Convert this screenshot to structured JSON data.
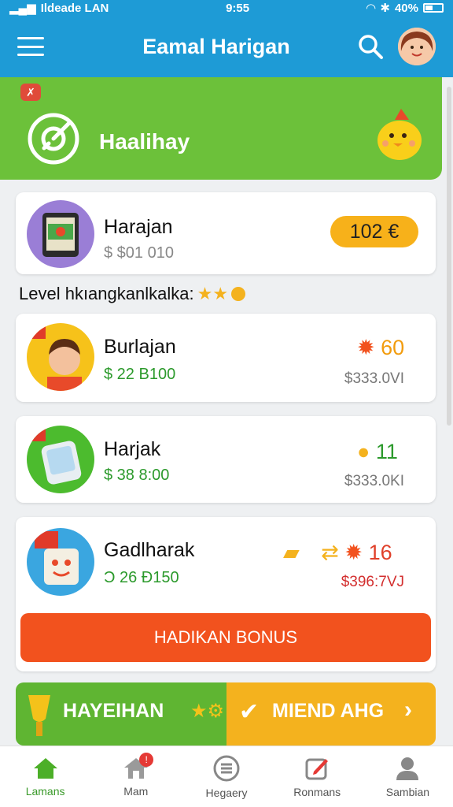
{
  "status_bar": {
    "left": "Ildeade LAN",
    "time": "9:55",
    "battery": "40%"
  },
  "header": {
    "title": "Eamal Harigan"
  },
  "banner": {
    "badge": "✗",
    "title": "Haalihay"
  },
  "featured": {
    "name": "Harajan",
    "price": "$ $01 010",
    "pill": "102 €"
  },
  "level": {
    "text": "Level hkıangkanlkalka:"
  },
  "items": [
    {
      "name": "Burlajan",
      "price": "$ 22 B100",
      "value": "60",
      "sub": "$333.0VI"
    },
    {
      "name": "Harjak",
      "price": "$ 38 8:00",
      "value": "11",
      "sub": "$333.0KI"
    },
    {
      "name": "Gadlharak",
      "price": "Ͻ 26 Ð150",
      "value": "16",
      "sub": "$396:7VJ",
      "cta": "HADIKAN BONUS"
    }
  ],
  "promos": {
    "left": "HAYEIHAN",
    "right": "MIEND AHG"
  },
  "nav": [
    {
      "label": "Lamans"
    },
    {
      "label": "Mam",
      "badge": "!"
    },
    {
      "label": "Hegaery"
    },
    {
      "label": "Ronmans"
    },
    {
      "label": "Sambian"
    }
  ],
  "colors": {
    "blue": "#1e9bd6",
    "green": "#6cc13a",
    "orange": "#f2521e",
    "gold": "#f7b11a"
  }
}
